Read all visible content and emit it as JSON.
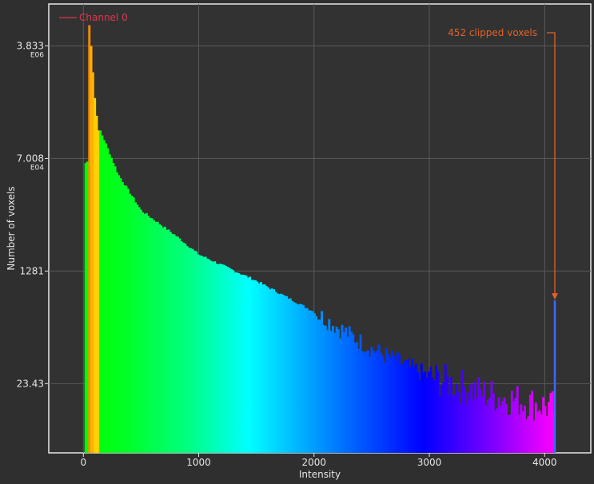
{
  "chart_data": {
    "type": "bar",
    "title": "",
    "xlabel": "Intensity",
    "ylabel": "Number of voxels",
    "y_scale": "log",
    "xlim": [
      -300,
      4400
    ],
    "ylim": [
      2,
      17000000
    ],
    "grid": true,
    "x_ticks": [
      {
        "value": 0,
        "label": "0"
      },
      {
        "value": 1000,
        "label": "1000"
      },
      {
        "value": 2000,
        "label": "2000"
      },
      {
        "value": 3000,
        "label": "3000"
      },
      {
        "value": 4000,
        "label": "4000"
      }
    ],
    "y_ticks": [
      {
        "value": 23.43,
        "label": "23.43",
        "exp": ""
      },
      {
        "value": 1281,
        "label": "1281",
        "exp": ""
      },
      {
        "value": 70080,
        "label": "7.008",
        "exp": "E04"
      },
      {
        "value": 3833000,
        "label": "3.833",
        "exp": "E06"
      }
    ],
    "series": [
      {
        "name": "Channel 0",
        "color": "#e0364a",
        "bin_start": 10,
        "bin_width": 16,
        "spikes": [
          {
            "x": 46,
            "y": 8000000
          },
          {
            "x": 62,
            "y": 3800000
          },
          {
            "x": 78,
            "y": 1500000
          },
          {
            "x": 94,
            "y": 600000
          },
          {
            "x": 110,
            "y": 320000
          },
          {
            "x": 126,
            "y": 190000
          }
        ],
        "decay_anchors": [
          [
            30,
            60000
          ],
          [
            140,
            200000
          ],
          [
            200,
            110000
          ],
          [
            300,
            40000
          ],
          [
            500,
            11000
          ],
          [
            800,
            4500
          ],
          [
            1000,
            2300
          ],
          [
            1500,
            900
          ],
          [
            2000,
            300
          ],
          [
            2500,
            80
          ],
          [
            3000,
            30
          ],
          [
            3500,
            16
          ],
          [
            4080,
            10
          ]
        ],
        "clipped_bin": {
          "x": 4088,
          "y": 452
        }
      }
    ],
    "colormap": [
      "#00ff00",
      "#00ffff",
      "#0000ff",
      "#8000ff",
      "#ff00ff"
    ],
    "annotation": {
      "text": "452 clipped voxels",
      "color": "#e0632a",
      "target_x": 4088,
      "target_y": 452
    },
    "legend": {
      "position": "top-left",
      "entries": [
        "Channel 0"
      ]
    }
  }
}
